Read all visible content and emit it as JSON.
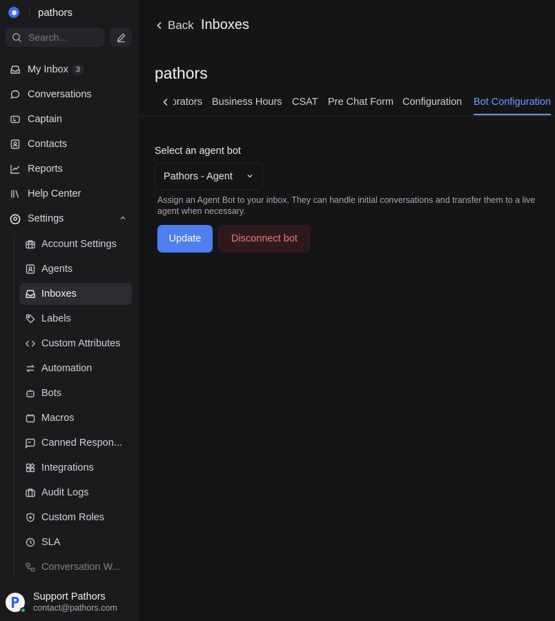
{
  "brand": {
    "name": "pathors",
    "logo_icon": "chatwoot-logo-icon"
  },
  "search": {
    "placeholder": "Search..."
  },
  "nav": {
    "my_inbox": {
      "label": "My Inbox",
      "badge": "3"
    },
    "conversations": "Conversations",
    "captain": "Captain",
    "contacts": "Contacts",
    "reports": "Reports",
    "help_center": "Help Center",
    "settings": "Settings"
  },
  "settings_items": [
    {
      "label": "Account Settings",
      "icon": "briefcase-icon"
    },
    {
      "label": "Agents",
      "icon": "agent-icon"
    },
    {
      "label": "Inboxes",
      "icon": "inbox-icon",
      "active": true
    },
    {
      "label": "Labels",
      "icon": "tag-icon"
    },
    {
      "label": "Custom Attributes",
      "icon": "code-icon"
    },
    {
      "label": "Automation",
      "icon": "automation-icon"
    },
    {
      "label": "Bots",
      "icon": "bot-icon"
    },
    {
      "label": "Macros",
      "icon": "macro-icon"
    },
    {
      "label": "Canned Respon...",
      "icon": "canned-response-icon"
    },
    {
      "label": "Integrations",
      "icon": "integrations-icon"
    },
    {
      "label": "Audit Logs",
      "icon": "audit-log-icon"
    },
    {
      "label": "Custom Roles",
      "icon": "shield-icon"
    },
    {
      "label": "SLA",
      "icon": "clock-icon"
    },
    {
      "label": "Conversation W...",
      "icon": "workflow-icon"
    }
  ],
  "user": {
    "name": "Support Pathors",
    "email": "contact@pathors.com",
    "status_color": "#34b27b"
  },
  "header": {
    "back_label": "Back",
    "title": "Inboxes"
  },
  "inbox": {
    "name": "pathors"
  },
  "tabs": [
    {
      "label": "Collaborators"
    },
    {
      "label": "Business Hours"
    },
    {
      "label": "CSAT"
    },
    {
      "label": "Pre Chat Form"
    },
    {
      "label": "Configuration"
    },
    {
      "label": "Bot Configuration",
      "active": true
    }
  ],
  "bot_config": {
    "field_label": "Select an agent bot",
    "selected_bot": "Pathors - Agent",
    "help_text": "Assign an Agent Bot to your inbox. They can handle initial conversations and transfer them to a live agent when necessary.",
    "update_label": "Update",
    "disconnect_label": "Disconnect bot"
  },
  "colors": {
    "accent": "#4e7ef0",
    "danger": "#f07a7a",
    "background": "#151517"
  }
}
